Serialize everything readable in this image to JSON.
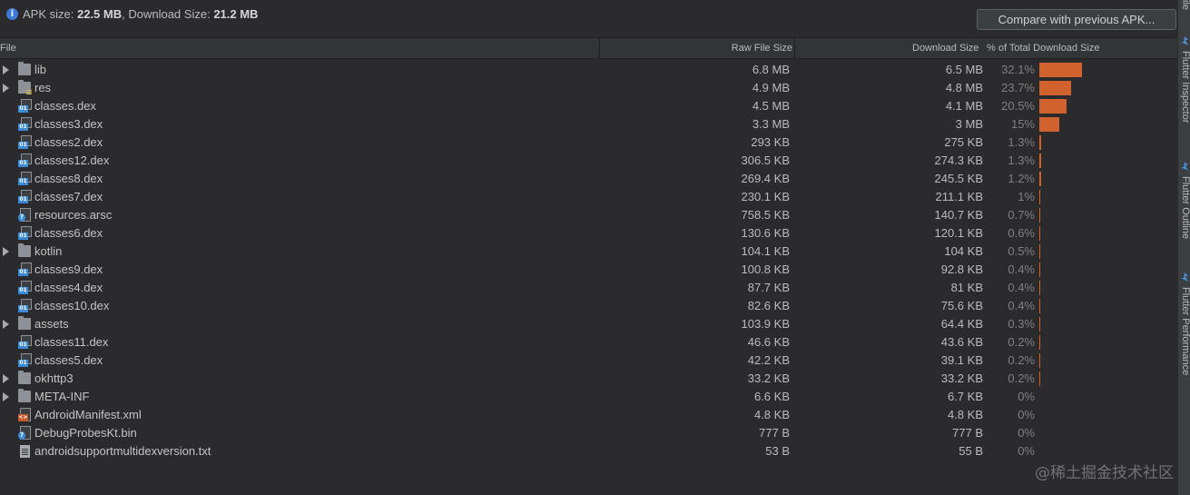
{
  "header": {
    "info_icon": "info-icon",
    "apk_label": "APK size:",
    "apk_size": "22.5 MB",
    "download_label": ", Download Size:",
    "download_size": "21.2 MB",
    "compare_button": "Compare with previous APK..."
  },
  "columns": {
    "file": "File",
    "raw": "Raw File Size",
    "download": "Download Size",
    "percent": "% of Total Download Size"
  },
  "rows": [
    {
      "name": "lib",
      "type": "folder",
      "expandable": true,
      "raw": "6.8 MB",
      "download": "6.5 MB",
      "percent": "32.1%",
      "fraction": 0.321
    },
    {
      "name": "res",
      "type": "res-folder",
      "expandable": true,
      "raw": "4.9 MB",
      "download": "4.8 MB",
      "percent": "23.7%",
      "fraction": 0.237
    },
    {
      "name": "classes.dex",
      "type": "dex",
      "expandable": false,
      "raw": "4.5 MB",
      "download": "4.1 MB",
      "percent": "20.5%",
      "fraction": 0.205
    },
    {
      "name": "classes3.dex",
      "type": "dex",
      "expandable": false,
      "raw": "3.3 MB",
      "download": "3 MB",
      "percent": "15%",
      "fraction": 0.15
    },
    {
      "name": "classes2.dex",
      "type": "dex",
      "expandable": false,
      "raw": "293 KB",
      "download": "275 KB",
      "percent": "1.3%",
      "fraction": 0.013
    },
    {
      "name": "classes12.dex",
      "type": "dex",
      "expandable": false,
      "raw": "306.5 KB",
      "download": "274.3 KB",
      "percent": "1.3%",
      "fraction": 0.013
    },
    {
      "name": "classes8.dex",
      "type": "dex",
      "expandable": false,
      "raw": "269.4 KB",
      "download": "245.5 KB",
      "percent": "1.2%",
      "fraction": 0.012
    },
    {
      "name": "classes7.dex",
      "type": "dex",
      "expandable": false,
      "raw": "230.1 KB",
      "download": "211.1 KB",
      "percent": "1%",
      "fraction": 0.01
    },
    {
      "name": "resources.arsc",
      "type": "unknown",
      "expandable": false,
      "raw": "758.5 KB",
      "download": "140.7 KB",
      "percent": "0.7%",
      "fraction": 0.007
    },
    {
      "name": "classes6.dex",
      "type": "dex",
      "expandable": false,
      "raw": "130.6 KB",
      "download": "120.1 KB",
      "percent": "0.6%",
      "fraction": 0.006
    },
    {
      "name": "kotlin",
      "type": "folder",
      "expandable": true,
      "raw": "104.1 KB",
      "download": "104 KB",
      "percent": "0.5%",
      "fraction": 0.005
    },
    {
      "name": "classes9.dex",
      "type": "dex",
      "expandable": false,
      "raw": "100.8 KB",
      "download": "92.8 KB",
      "percent": "0.4%",
      "fraction": 0.004
    },
    {
      "name": "classes4.dex",
      "type": "dex",
      "expandable": false,
      "raw": "87.7 KB",
      "download": "81 KB",
      "percent": "0.4%",
      "fraction": 0.004
    },
    {
      "name": "classes10.dex",
      "type": "dex",
      "expandable": false,
      "raw": "82.6 KB",
      "download": "75.6 KB",
      "percent": "0.4%",
      "fraction": 0.004
    },
    {
      "name": "assets",
      "type": "folder",
      "expandable": true,
      "raw": "103.9 KB",
      "download": "64.4 KB",
      "percent": "0.3%",
      "fraction": 0.003
    },
    {
      "name": "classes11.dex",
      "type": "dex",
      "expandable": false,
      "raw": "46.6 KB",
      "download": "43.6 KB",
      "percent": "0.2%",
      "fraction": 0.002
    },
    {
      "name": "classes5.dex",
      "type": "dex",
      "expandable": false,
      "raw": "42.2 KB",
      "download": "39.1 KB",
      "percent": "0.2%",
      "fraction": 0.002
    },
    {
      "name": "okhttp3",
      "type": "folder",
      "expandable": true,
      "raw": "33.2 KB",
      "download": "33.2 KB",
      "percent": "0.2%",
      "fraction": 0.002
    },
    {
      "name": "META-INF",
      "type": "folder",
      "expandable": true,
      "raw": "6.6 KB",
      "download": "6.7 KB",
      "percent": "0%",
      "fraction": 0
    },
    {
      "name": "AndroidManifest.xml",
      "type": "xml",
      "expandable": false,
      "raw": "4.8 KB",
      "download": "4.8 KB",
      "percent": "0%",
      "fraction": 0
    },
    {
      "name": "DebugProbesKt.bin",
      "type": "unknown",
      "expandable": false,
      "raw": "777 B",
      "download": "777 B",
      "percent": "0%",
      "fraction": 0
    },
    {
      "name": "androidsupportmultidexversion.txt",
      "type": "txt",
      "expandable": false,
      "raw": "53 B",
      "download": "55 B",
      "percent": "0%",
      "fraction": 0
    }
  ],
  "side_panel": {
    "top_label": "ile",
    "items": [
      {
        "label": "Flutter Inspector",
        "icon": "flutter-icon"
      },
      {
        "label": "Flutter Outline",
        "icon": "flutter-icon"
      },
      {
        "label": "Flutter Performance",
        "icon": "flutter-icon"
      }
    ]
  },
  "watermark": "@稀土掘金技术社区",
  "colors": {
    "background": "#2b2b2d",
    "bar": "#d2622d",
    "accent": "#3d7ad6"
  }
}
